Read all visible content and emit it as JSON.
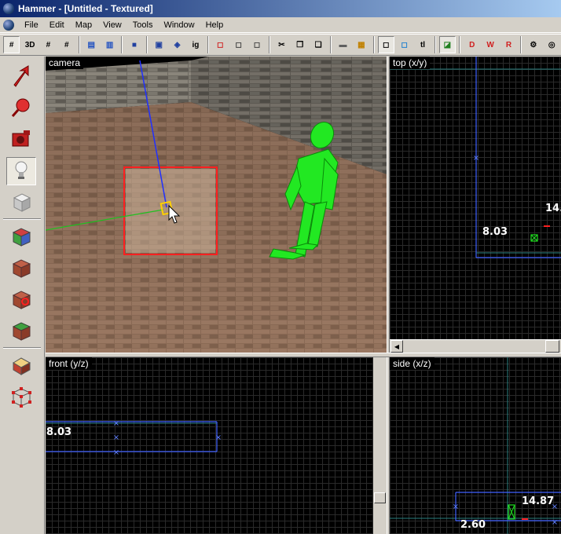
{
  "window": {
    "title": "Hammer - [Untitled - Textured]"
  },
  "menu": [
    "File",
    "Edit",
    "Map",
    "View",
    "Tools",
    "Window",
    "Help"
  ],
  "toolbar": {
    "buttons": [
      {
        "name": "grid-toggle-button",
        "icon": "grid-icon",
        "label": "#",
        "pressed": true
      },
      {
        "name": "3d-grid-button",
        "icon": "3d-grid-icon",
        "label": "3D",
        "pressed": false
      },
      {
        "name": "grid-smaller-button",
        "icon": "grid-smaller-icon",
        "label": "#",
        "pressed": false
      },
      {
        "name": "grid-larger-button",
        "icon": "grid-larger-icon",
        "label": "#",
        "pressed": false
      },
      {
        "sep": true
      },
      {
        "name": "group-button",
        "icon": "group-icon",
        "label": "",
        "pressed": false
      },
      {
        "name": "ungroup-button",
        "icon": "ungroup-icon",
        "label": "",
        "pressed": false
      },
      {
        "sep": true
      },
      {
        "name": "to-world-button",
        "icon": "to-world-icon",
        "label": "",
        "pressed": false
      },
      {
        "sep": true
      },
      {
        "name": "to-entity-button",
        "icon": "to-entity-icon",
        "label": "",
        "pressed": false
      },
      {
        "name": "hide-selected-button",
        "icon": "hide-icon",
        "label": "",
        "pressed": false
      },
      {
        "name": "ignore-groups-button",
        "icon": "ignore-groups-icon",
        "label": "ig",
        "pressed": false
      },
      {
        "sep": true
      },
      {
        "name": "carve-button",
        "icon": "carve-icon",
        "label": "",
        "pressed": false
      },
      {
        "name": "hollow-button",
        "icon": "hollow-icon",
        "label": "",
        "pressed": false
      },
      {
        "name": "copy-object-button",
        "icon": "copy-object-icon",
        "label": "",
        "pressed": false
      },
      {
        "sep": true
      },
      {
        "name": "cut-button",
        "icon": "scissors-icon",
        "label": "✂",
        "pressed": false
      },
      {
        "name": "copy-button",
        "icon": "copy-icon",
        "label": "",
        "pressed": false
      },
      {
        "name": "paste-button",
        "icon": "paste-icon",
        "label": "",
        "pressed": false
      },
      {
        "sep": true
      },
      {
        "name": "texture-lock-button",
        "icon": "texture-lock-icon",
        "label": "",
        "pressed": false
      },
      {
        "name": "tie-to-entity-button",
        "icon": "hazard-icon",
        "label": "",
        "pressed": false
      },
      {
        "sep": true
      },
      {
        "name": "selection-box-button",
        "icon": "selection-box-icon",
        "label": "",
        "pressed": true
      },
      {
        "name": "texture-select-button",
        "icon": "texture-select-icon",
        "label": "",
        "pressed": false
      },
      {
        "name": "texture-lock-toggle-button",
        "icon": "text-tl-icon",
        "label": "tl",
        "pressed": false
      },
      {
        "sep": true
      },
      {
        "name": "flip-button",
        "icon": "flip-icon",
        "label": "",
        "pressed": true
      },
      {
        "sep": true
      },
      {
        "name": "run-button",
        "icon": "run-d-icon",
        "label": "D",
        "pressed": false
      },
      {
        "name": "run-vis-button",
        "icon": "run-w-icon",
        "label": "W",
        "pressed": false
      },
      {
        "name": "run-rad-button",
        "icon": "run-r-icon",
        "label": "R",
        "pressed": false
      },
      {
        "sep": true
      },
      {
        "name": "settings-button",
        "icon": "gear-icon",
        "label": "",
        "pressed": false
      },
      {
        "name": "options-button",
        "icon": "sphere-icon",
        "label": "",
        "pressed": false
      }
    ]
  },
  "tools": [
    {
      "name": "tool-pointer",
      "icon": "pointer-arrow-icon",
      "pressed": false
    },
    {
      "name": "tool-magnify",
      "icon": "magnify-icon",
      "pressed": false
    },
    {
      "name": "tool-camera",
      "icon": "camera-icon",
      "pressed": false
    },
    {
      "name": "tool-entity",
      "icon": "lightbulb-icon",
      "pressed": true
    },
    {
      "name": "tool-block",
      "icon": "block-icon",
      "pressed": false
    },
    {
      "sep": true
    },
    {
      "name": "tool-texture-app",
      "icon": "textured-cube-icon",
      "pressed": false
    },
    {
      "name": "tool-apply-texture",
      "icon": "brick-cube-icon",
      "pressed": false
    },
    {
      "name": "tool-apply-decal",
      "icon": "decal-cube-icon",
      "pressed": false
    },
    {
      "name": "tool-apply-overlay",
      "icon": "overlay-cube-icon",
      "pressed": false
    },
    {
      "sep": true
    },
    {
      "name": "tool-clip",
      "icon": "clip-icon",
      "pressed": false
    },
    {
      "name": "tool-vertex",
      "icon": "vertex-icon",
      "pressed": false
    }
  ],
  "views": {
    "camera": {
      "label": "camera"
    },
    "top": {
      "label": "top (x/y)",
      "dims": [
        "8.03",
        "14."
      ]
    },
    "front": {
      "label": "front (y/z)",
      "dims": [
        "8.03"
      ]
    },
    "side": {
      "label": "side (x/z)",
      "dims": [
        "14.87",
        "2.60"
      ]
    }
  },
  "colors": {
    "selection": "#ff2020",
    "brush_outline": "#4060ff",
    "grid_axis": "#2a8080",
    "entity": "#20e020"
  }
}
